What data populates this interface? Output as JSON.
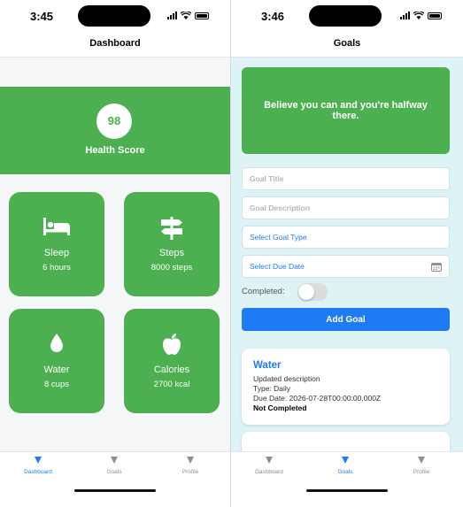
{
  "dashboard": {
    "status_time": "3:45",
    "nav_title": "Dashboard",
    "health": {
      "score": "98",
      "label": "Health Score"
    },
    "cards": [
      {
        "icon": "bed-icon",
        "title": "Sleep",
        "value": "6 hours"
      },
      {
        "icon": "signpost-icon",
        "title": "Steps",
        "value": "8000 steps"
      },
      {
        "icon": "drop-icon",
        "title": "Water",
        "value": "8 cups"
      },
      {
        "icon": "apple-icon",
        "title": "Calories",
        "value": "2700 kcal"
      }
    ],
    "tabs": [
      {
        "label": "Dashboard",
        "active": true
      },
      {
        "label": "Goals",
        "active": false
      },
      {
        "label": "Profile",
        "active": false
      }
    ]
  },
  "goals": {
    "status_time": "3:46",
    "nav_title": "Goals",
    "quote": "Believe you can and you're halfway there.",
    "fields": {
      "title_placeholder": "Goal Title",
      "description_placeholder": "Goal Description",
      "type_select": "Select Goal Type",
      "due_date_select": "Select Due Date"
    },
    "completed_label": "Completed:",
    "completed_value": false,
    "add_button": "Add Goal",
    "goal_list": [
      {
        "title": "Water",
        "description": "Updated description",
        "type": "Type: Daily",
        "due_date": "Due Date: 2026-07-28T00:00:00.000Z",
        "status": "Not Completed"
      }
    ],
    "tabs": [
      {
        "label": "Dashboard",
        "active": false
      },
      {
        "label": "Goals",
        "active": true
      },
      {
        "label": "Profile",
        "active": false
      }
    ]
  },
  "colors": {
    "green": "#4caf50",
    "blue": "#1e7bf6",
    "tab_inactive": "#8e8e93"
  }
}
